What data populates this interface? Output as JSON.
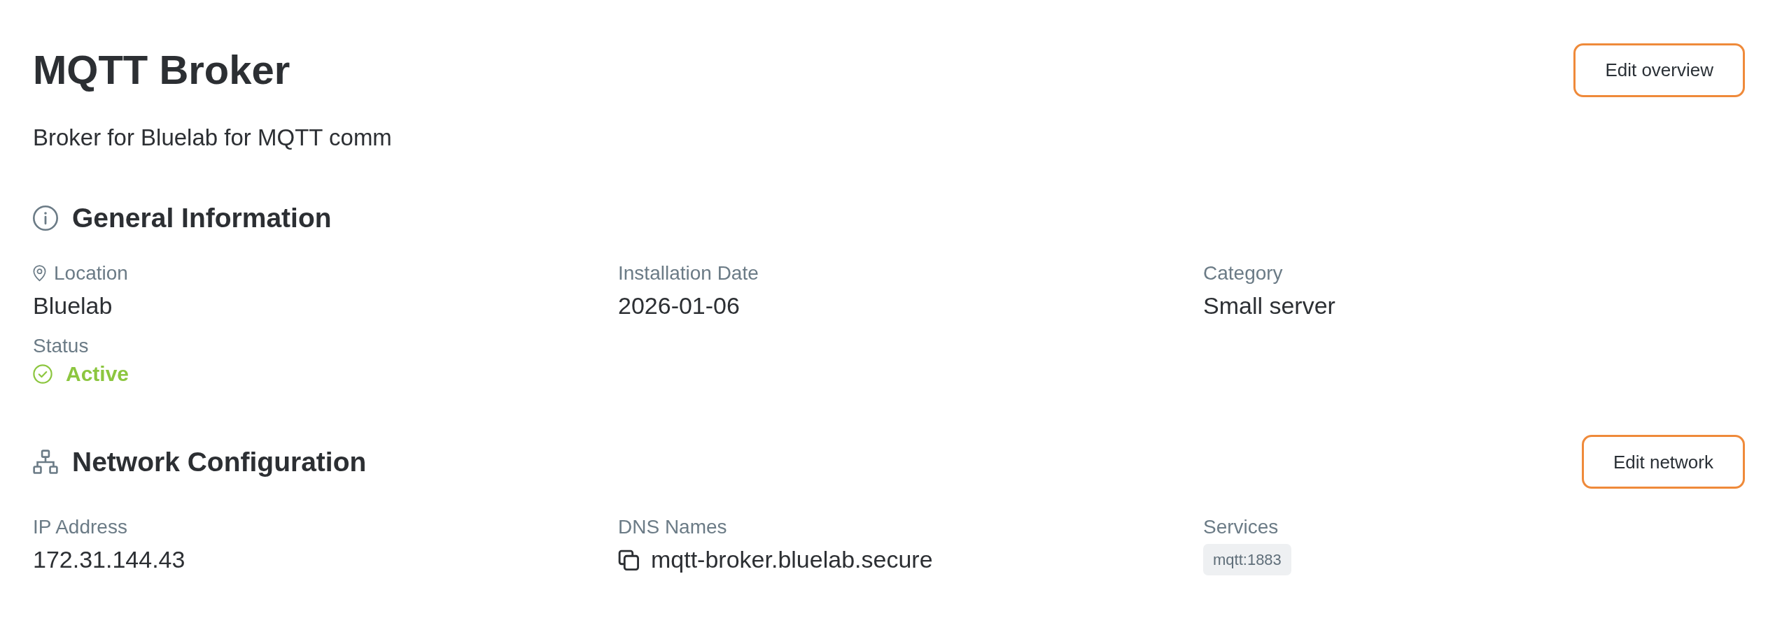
{
  "header": {
    "title": "MQTT Broker",
    "description": "Broker for Bluelab for MQTT comm",
    "edit_button": "Edit overview"
  },
  "sections": [
    {
      "kind": "general",
      "title": "General Information",
      "fields": [
        {
          "kind": "location",
          "label": "Location",
          "value": "Bluelab"
        },
        {
          "kind": "text",
          "label": "Installation Date",
          "value": "2026-01-06"
        },
        {
          "kind": "text",
          "label": "Category",
          "value": "Small server"
        },
        {
          "kind": "status",
          "label": "Status",
          "value": "Active"
        }
      ]
    },
    {
      "kind": "network",
      "title": "Network Configuration",
      "edit_button": "Edit network",
      "fields": [
        {
          "kind": "text",
          "label": "IP Address",
          "value": "172.31.144.43"
        },
        {
          "kind": "copy",
          "label": "DNS Names",
          "value": "mqtt-broker.bluelab.secure"
        },
        {
          "kind": "tags",
          "label": "Services",
          "tags": [
            "mqtt:1883"
          ]
        }
      ]
    }
  ]
}
